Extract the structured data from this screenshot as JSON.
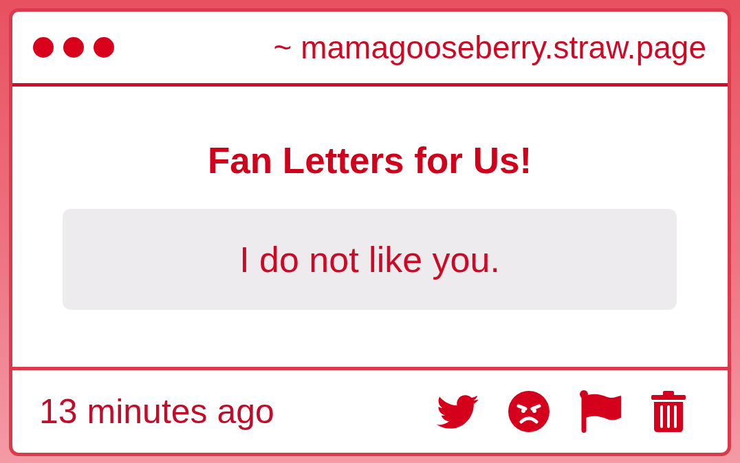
{
  "window": {
    "address": "~ mamagooseberry.straw.page"
  },
  "title": "Fan Letters for Us!",
  "letter": {
    "text": "I do not like you."
  },
  "footer": {
    "time": "13 minutes ago"
  }
}
